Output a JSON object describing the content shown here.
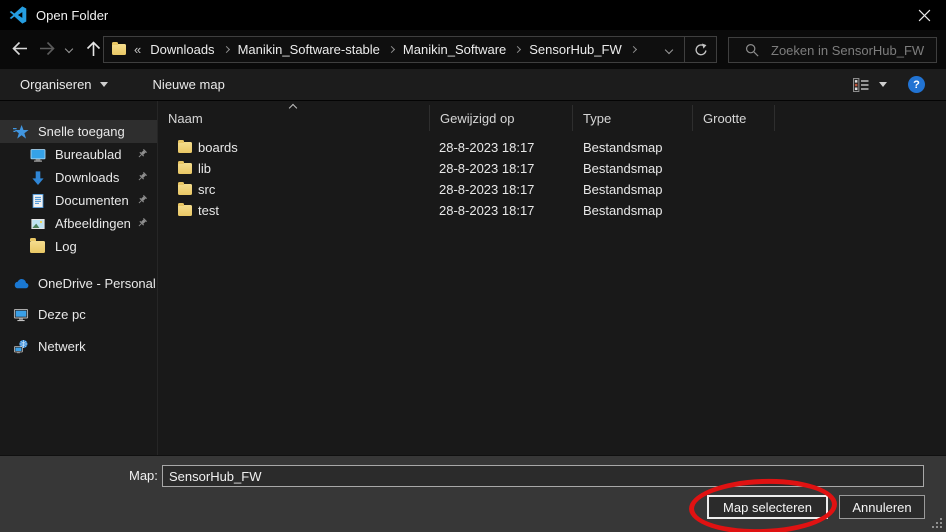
{
  "window": {
    "title": "Open Folder"
  },
  "navbar": {
    "breadcrumb_overflow": "«",
    "breadcrumb_items": [
      "Downloads",
      "Manikin_Software-stable",
      "Manikin_Software",
      "SensorHub_FW"
    ],
    "search_placeholder": "Zoeken in SensorHub_FW"
  },
  "toolbar": {
    "organize": "Organiseren",
    "new_folder": "Nieuwe map",
    "help_glyph": "?"
  },
  "sidebar": {
    "items": [
      {
        "label": "Snelle toegang",
        "icon": "quick-access-star-icon",
        "selected": true
      },
      {
        "label": "Bureaublad",
        "icon": "desktop-icon",
        "pinned": true
      },
      {
        "label": "Downloads",
        "icon": "download-arrow-icon",
        "pinned": true
      },
      {
        "label": "Documenten",
        "icon": "document-icon",
        "pinned": true
      },
      {
        "label": "Afbeeldingen",
        "icon": "picture-icon",
        "pinned": true
      },
      {
        "label": "Log",
        "icon": "folder-icon",
        "pinned": false
      },
      {
        "label": "OneDrive - Personal",
        "icon": "onedrive-cloud-icon"
      },
      {
        "label": "Deze pc",
        "icon": "this-pc-icon"
      },
      {
        "label": "Netwerk",
        "icon": "network-icon"
      }
    ]
  },
  "list": {
    "columns": [
      "Naam",
      "Gewijzigd op",
      "Type",
      "Grootte"
    ],
    "sort": {
      "column": "Naam",
      "direction": "ascending"
    },
    "rows": [
      {
        "name": "boards",
        "modified": "28-8-2023 18:17",
        "type": "Bestandsmap",
        "size": ""
      },
      {
        "name": "lib",
        "modified": "28-8-2023 18:17",
        "type": "Bestandsmap",
        "size": ""
      },
      {
        "name": "src",
        "modified": "28-8-2023 18:17",
        "type": "Bestandsmap",
        "size": ""
      },
      {
        "name": "test",
        "modified": "28-8-2023 18:17",
        "type": "Bestandsmap",
        "size": ""
      }
    ]
  },
  "footer": {
    "folder_label": "Map:",
    "folder_value": "SensorHub_FW",
    "select_label": "Map selecteren",
    "cancel_label": "Annuleren"
  },
  "colors": {
    "accent_blue": "#2f86d6",
    "help_blue": "#2173d3",
    "folder_yellow": "#e9c764",
    "annotation_red": "#e01212",
    "footer_gray": "#373737"
  }
}
